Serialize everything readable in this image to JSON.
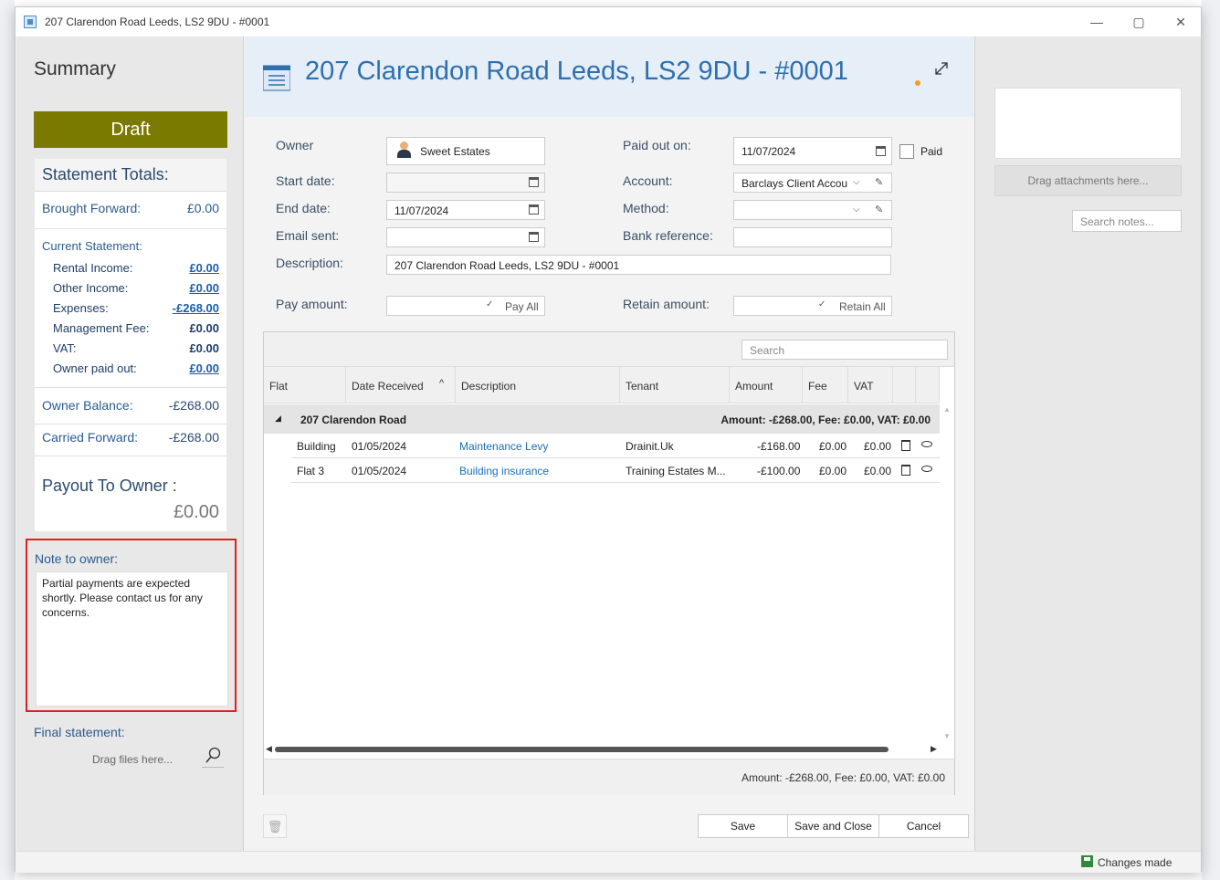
{
  "window": {
    "title": "207 Clarendon Road Leeds, LS2 9DU - #0001",
    "min_glyph": "—",
    "max_glyph": "▢",
    "close_glyph": "✕"
  },
  "summary": {
    "title": "Summary",
    "status": "Draft",
    "totals_header": "Statement Totals:",
    "brought_forward_label": "Brought Forward:",
    "brought_forward_value": "£0.00",
    "current_statement_label": "Current Statement:",
    "current_items": [
      {
        "label": "Rental Income:",
        "value": "£0.00",
        "link": true
      },
      {
        "label": "Other Income:",
        "value": "£0.00",
        "link": true
      },
      {
        "label": "Expenses:",
        "value": "-£268.00",
        "link": true
      },
      {
        "label": "Management Fee:",
        "value": "£0.00",
        "link": false
      },
      {
        "label": "VAT:",
        "value": "£0.00",
        "link": false
      },
      {
        "label": "Owner paid out:",
        "value": "£0.00",
        "link": true
      }
    ],
    "owner_balance_label": "Owner Balance:",
    "owner_balance_value": "-£268.00",
    "carried_forward_label": "Carried Forward:",
    "carried_forward_value": "-£268.00",
    "payout_label": "Payout To Owner :",
    "payout_value": "£0.00",
    "note_label": "Note to owner:",
    "note_text": "Partial payments are expected shortly. Please contact us for any concerns.",
    "final_statement_label": "Final statement:",
    "drag_files_placeholder": "Drag files here..."
  },
  "header": {
    "title": "207 Clarendon Road Leeds, LS2 9DU - #0001"
  },
  "form": {
    "owner_label": "Owner",
    "owner_value": "Sweet Estates",
    "start_date_label": "Start date:",
    "start_date_value": "",
    "end_date_label": "End date:",
    "end_date_value": "11/07/2024",
    "email_sent_label": "Email sent:",
    "email_sent_value": "",
    "description_label": "Description:",
    "description_value": "207 Clarendon Road Leeds, LS2 9DU - #0001",
    "pay_amount_label": "Pay amount:",
    "pay_all_label": "Pay All",
    "paid_out_on_label": "Paid out on:",
    "paid_out_on_value": "11/07/2024",
    "paid_label": "Paid",
    "account_label": "Account:",
    "account_value": "Barclays Client Accou",
    "method_label": "Method:",
    "method_value": "",
    "bank_reference_label": "Bank reference:",
    "bank_reference_value": "",
    "retain_amount_label": "Retain amount:",
    "retain_all_label": "Retain All"
  },
  "grid": {
    "search_placeholder": "Search",
    "columns": [
      "Flat",
      "Date Received",
      "Description",
      "Tenant",
      "Amount",
      "Fee",
      "VAT"
    ],
    "group": {
      "name": "207 Clarendon Road",
      "summary": "Amount: -£268.00,   Fee: £0.00,   VAT: £0.00"
    },
    "rows": [
      {
        "flat": "Building",
        "date": "01/05/2024",
        "description": "Maintenance Levy",
        "tenant": "Drainit.Uk",
        "amount": "-£168.00",
        "fee": "£0.00",
        "vat": "£0.00"
      },
      {
        "flat": "Flat 3",
        "date": "01/05/2024",
        "description": "Building insurance",
        "tenant": "Training Estates M...",
        "amount": "-£100.00",
        "fee": "£0.00",
        "vat": "£0.00"
      }
    ],
    "footer": "Amount: -£268.00, Fee: £0.00, VAT: £0.00"
  },
  "actions": {
    "save": "Save",
    "save_and_close": "Save and Close",
    "cancel": "Cancel"
  },
  "right_panel": {
    "drag_attachments": "Drag attachments here...",
    "search_notes_placeholder": "Search notes..."
  },
  "status": {
    "text": "Changes made"
  },
  "colors": {
    "draft": "#7b7a00",
    "title_blue": "#2e6fae",
    "highlight_red": "#e02020"
  }
}
